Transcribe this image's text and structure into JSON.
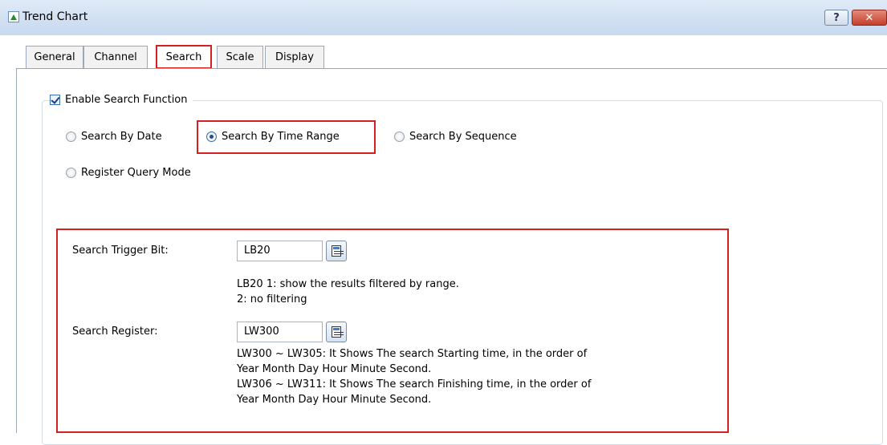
{
  "window": {
    "title": "Trend Chart",
    "help_label": "?",
    "close_label": "✕"
  },
  "tabs": [
    {
      "label": "General"
    },
    {
      "label": "Channel"
    },
    {
      "label": "Search"
    },
    {
      "label": "Scale"
    },
    {
      "label": "Display"
    }
  ],
  "search": {
    "enable_label": "Enable Search Function",
    "enable_checked": true,
    "modes": [
      {
        "label": "Search By Date",
        "selected": false
      },
      {
        "label": "Search By Time Range",
        "selected": true
      },
      {
        "label": "Search By Sequence",
        "selected": false
      },
      {
        "label": "Register Query Mode",
        "selected": false
      }
    ],
    "trigger_label": "Search Trigger Bit:",
    "trigger_value": "LB20",
    "trigger_desc_1": "LB20 1: show the results filtered by range.",
    "trigger_desc_2": "2: no filtering",
    "register_label": "Search Register:",
    "register_value": "LW300",
    "register_desc_1": "LW300 ~ LW305: It Shows The search Starting time, in the order of",
    "register_desc_2": "Year Month Day Hour Minute Second.",
    "register_desc_3": "LW306 ~ LW311: It Shows The search Finishing time, in the order of",
    "register_desc_4": "Year Month Day Hour Minute Second."
  },
  "colors": {
    "highlight": "#d42020",
    "titlebar": "#c6d9ee"
  }
}
